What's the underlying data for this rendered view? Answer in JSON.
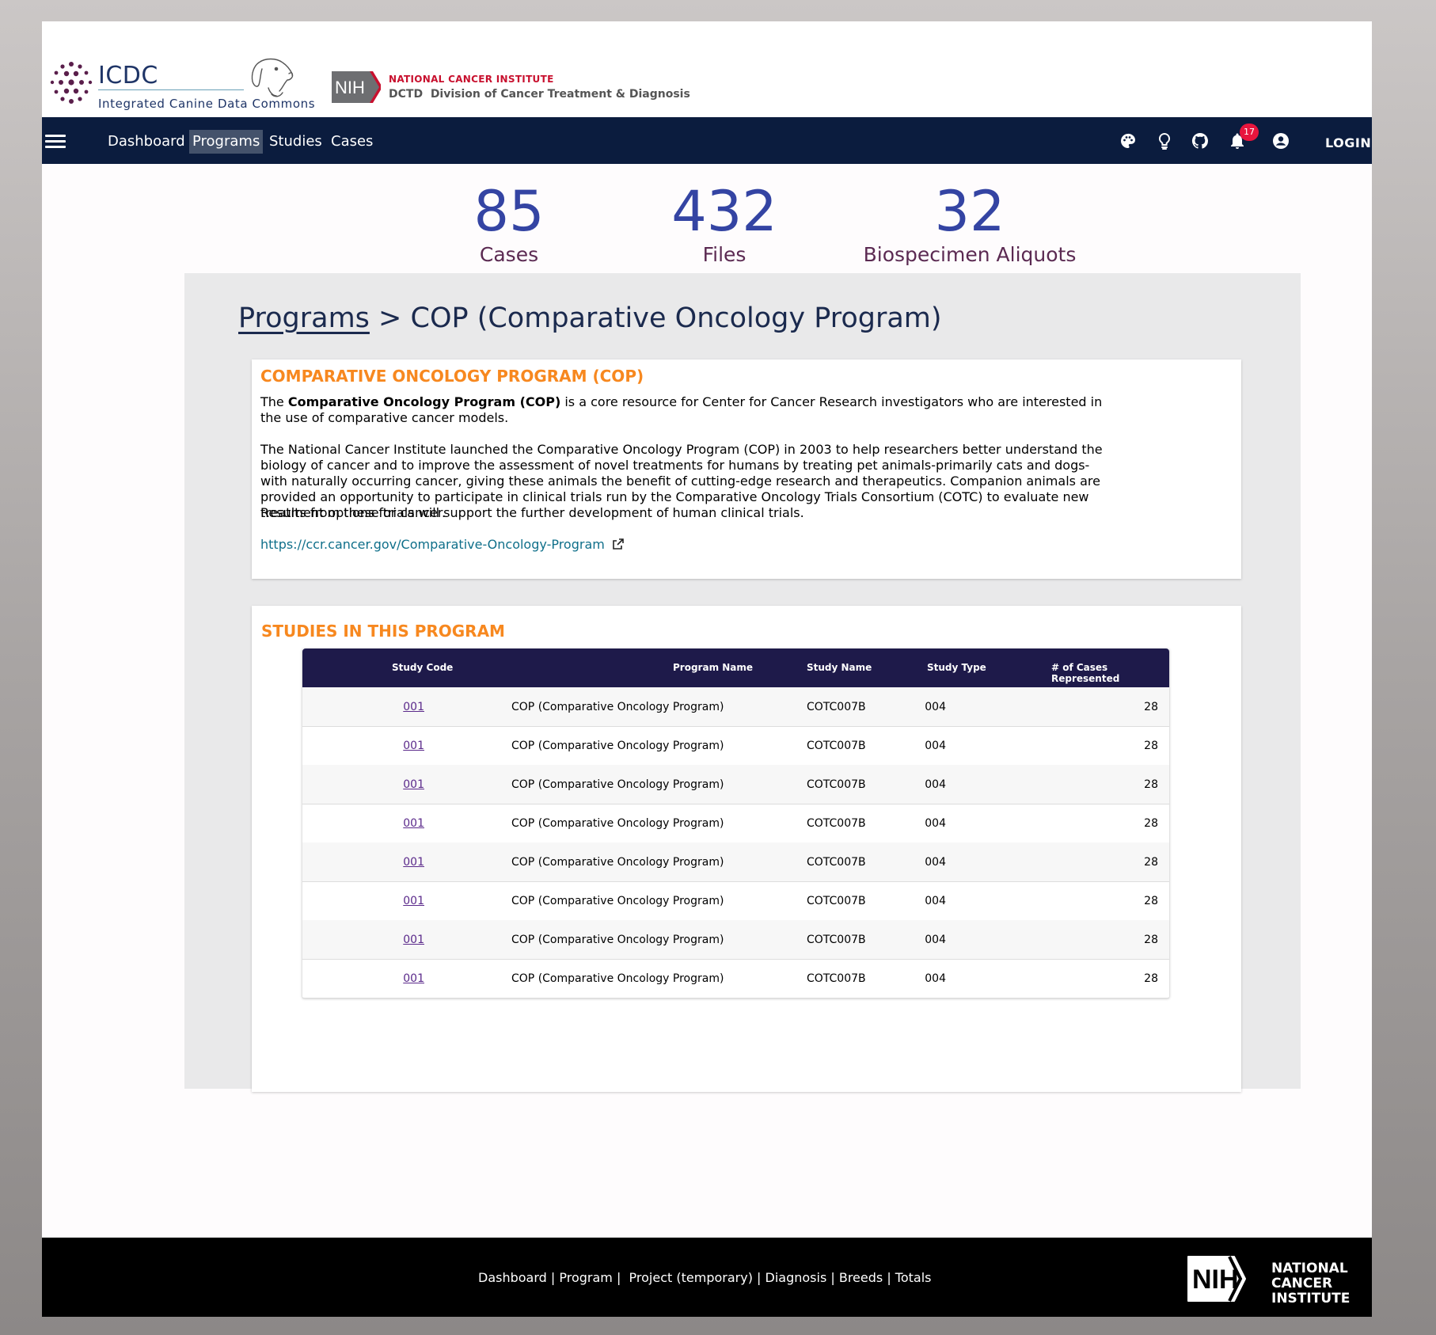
{
  "header": {
    "logo_title": "ICDC",
    "logo_subtitle": "Integrated Canine Data Commons",
    "nih_badge": "NIH",
    "nci_name": "NATIONAL CANCER INSTITUTE",
    "dctd_label": "DCTD  Division of Cancer Treatment & Diagnosis"
  },
  "nav": {
    "items": [
      {
        "label": "Dashboard"
      },
      {
        "label": "Programs",
        "active": true
      },
      {
        "label": "Studies"
      },
      {
        "label": "Cases"
      }
    ],
    "notification_count": "17",
    "login_label": "LOGIN",
    "icons": [
      "palette-icon",
      "lightbulb-icon",
      "github-icon",
      "bell-icon",
      "account-icon"
    ]
  },
  "stats": [
    {
      "value": "85",
      "label": "Cases"
    },
    {
      "value": "432",
      "label": "Files"
    },
    {
      "value": "32",
      "label": "Biospecimen Aliquots"
    }
  ],
  "breadcrumb": {
    "parent": "Programs",
    "separator": " > ",
    "current": "COP (Comparative Oncology Program)"
  },
  "program_card": {
    "title": "COMPARATIVE ONCOLOGY PROGRAM (COP)",
    "para1_prefix": "The ",
    "para1_bold": "Comparative Oncology Program (COP)",
    "para1_suffix": " is a core resource for Center for Cancer Research investigators who are interested in the use of comparative cancer models.",
    "para2": "The National Cancer Institute launched the Comparative Oncology Program (COP) in 2003 to help researchers better understand the biology of cancer and to improve the assessment of novel treatments for humans by treating pet animals-primarily cats and dogs-with naturally occurring cancer, giving these animals the benefit of cutting-edge research and therapeutics. Companion animals are provided an opportunity to participate in clinical trials run by the Comparative Oncology Trials Consortium (COTC) to evaluate new treatment options for cancer.",
    "para3": "Results from these trials will support the further development of human clinical trials.",
    "link": "https://ccr.cancer.gov/Comparative-Oncology-Program"
  },
  "studies_card": {
    "title": "STUDIES IN THIS PROGRAM",
    "columns": [
      "Study Code",
      "Program Name",
      "Study Name",
      "Study Type",
      "# of Cases Represented"
    ],
    "rows": [
      [
        "001",
        "COP (Comparative Oncology Program)",
        "COTC007B",
        "004",
        "28"
      ],
      [
        "001",
        "COP (Comparative Oncology Program)",
        "COTC007B",
        "004",
        "28"
      ],
      [
        "001",
        "COP (Comparative Oncology Program)",
        "COTC007B",
        "004",
        "28"
      ],
      [
        "001",
        "COP (Comparative Oncology Program)",
        "COTC007B",
        "004",
        "28"
      ],
      [
        "001",
        "COP (Comparative Oncology Program)",
        "COTC007B",
        "004",
        "28"
      ],
      [
        "001",
        "COP (Comparative Oncology Program)",
        "COTC007B",
        "004",
        "28"
      ],
      [
        "001",
        "COP (Comparative Oncology Program)",
        "COTC007B",
        "004",
        "28"
      ],
      [
        "001",
        "COP (Comparative Oncology Program)",
        "COTC007B",
        "004",
        "28"
      ]
    ]
  },
  "footer": {
    "links": [
      "Dashboard",
      "Program",
      "Project (temporary)",
      "Diagnosis",
      "Breeds",
      "Totals"
    ],
    "nih_badge": "NIH",
    "nci_lines": [
      "NATIONAL",
      "CANCER",
      "INSTITUTE"
    ]
  },
  "colors": {
    "nav_bg": "#0b1c3e",
    "stat_number": "#3444a3",
    "stat_label": "#5b2a52",
    "card_title": "#f7881f",
    "table_header": "#1e1a4a",
    "badge": "#e8153d"
  }
}
